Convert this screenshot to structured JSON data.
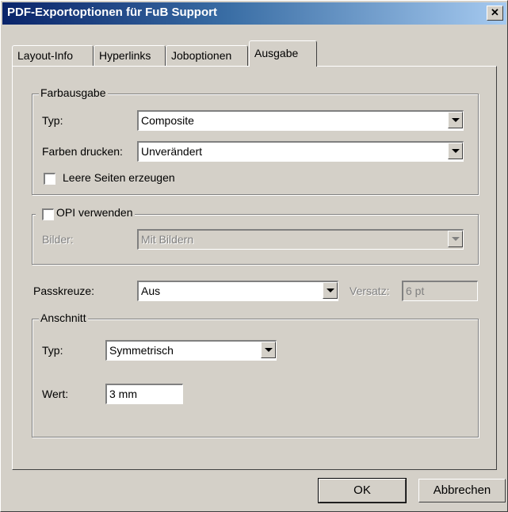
{
  "window": {
    "title": "PDF-Exportoptionen für FuB Support"
  },
  "tabs": [
    {
      "label": "Layout-Info"
    },
    {
      "label": "Hyperlinks"
    },
    {
      "label": "Joboptionen"
    },
    {
      "label": "Ausgabe"
    }
  ],
  "active_tab": "Ausgabe",
  "farbausgabe": {
    "legend": "Farbausgabe",
    "typ_label": "Typ:",
    "typ_value": "Composite",
    "farben_label": "Farben drucken:",
    "farben_value": "Unverändert",
    "leere_seiten_label": "Leere Seiten erzeugen",
    "leere_seiten_checked": false
  },
  "opi": {
    "legend": "OPI verwenden",
    "checked": false,
    "bilder_label": "Bilder:",
    "bilder_value": "Mit Bildern"
  },
  "passkreuze": {
    "label": "Passkreuze:",
    "value": "Aus",
    "versatz_label": "Versatz:",
    "versatz_value": "6 pt"
  },
  "anschnitt": {
    "legend": "Anschnitt",
    "typ_label": "Typ:",
    "typ_value": "Symmetrisch",
    "wert_label": "Wert:",
    "wert_value": "3 mm"
  },
  "buttons": {
    "ok": "OK",
    "cancel": "Abbrechen"
  }
}
